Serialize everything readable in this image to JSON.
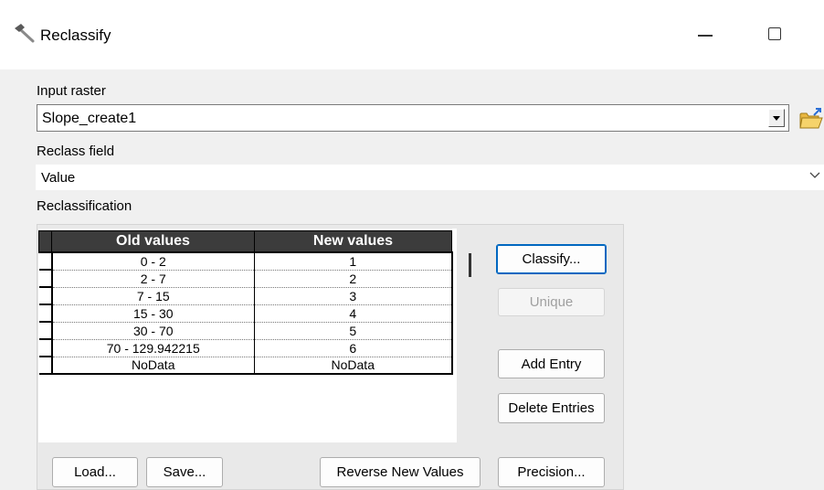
{
  "window": {
    "title": "Reclassify",
    "icon": "hammer-icon"
  },
  "input_raster": {
    "label": "Input raster",
    "value": "Slope_create1"
  },
  "reclass_field": {
    "label": "Reclass field",
    "value": "Value"
  },
  "reclassification": {
    "label": "Reclassification",
    "columns": [
      "Old values",
      "New values"
    ],
    "rows": [
      {
        "old": "0 - 2",
        "new": "1"
      },
      {
        "old": "2 - 7",
        "new": "2"
      },
      {
        "old": "7 - 15",
        "new": "3"
      },
      {
        "old": "15 - 30",
        "new": "4"
      },
      {
        "old": "30 - 70",
        "new": "5"
      },
      {
        "old": "70 - 129.942215",
        "new": "6"
      },
      {
        "old": "NoData",
        "new": "NoData"
      }
    ]
  },
  "buttons": {
    "classify": "Classify...",
    "unique": "Unique",
    "add_entry": "Add Entry",
    "delete_entries": "Delete Entries",
    "load": "Load...",
    "save": "Save...",
    "reverse": "Reverse New Values",
    "precision": "Precision..."
  }
}
